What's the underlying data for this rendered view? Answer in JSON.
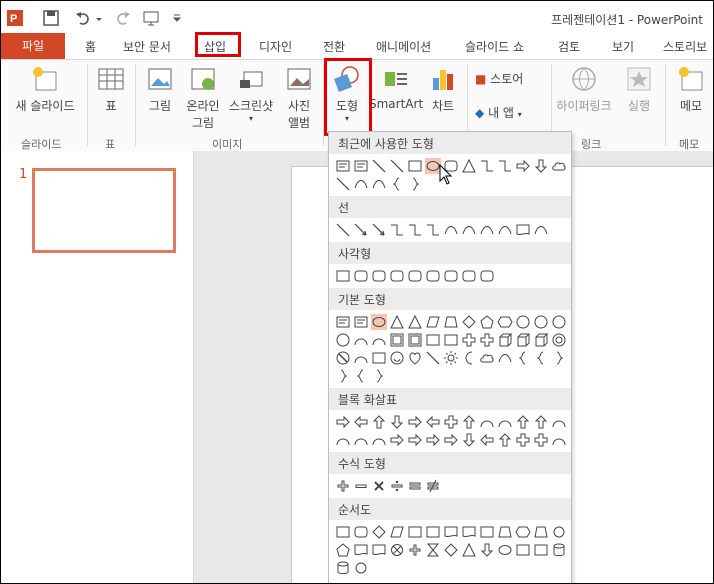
{
  "window": {
    "title": "프레젠테이션1 - PowerPoint"
  },
  "tabs": [
    {
      "label": "파일",
      "name": "tab-file"
    },
    {
      "label": "홈",
      "name": "tab-home"
    },
    {
      "label": "보안 문서",
      "name": "tab-security-document"
    },
    {
      "label": "삽입",
      "name": "tab-insert"
    },
    {
      "label": "디자인",
      "name": "tab-design"
    },
    {
      "label": "전환",
      "name": "tab-transitions"
    },
    {
      "label": "애니메이션",
      "name": "tab-animations"
    },
    {
      "label": "슬라이드 쇼",
      "name": "tab-slideshow"
    },
    {
      "label": "검토",
      "name": "tab-review"
    },
    {
      "label": "보기",
      "name": "tab-view"
    },
    {
      "label": "스토리보",
      "name": "tab-storyboard"
    }
  ],
  "ribbon": {
    "new_slide": "새 슬라이드",
    "table": "표",
    "picture": "그림",
    "online_picture_1": "온라인",
    "online_picture_2": "그림",
    "screenshot": "스크린샷",
    "photo_album_1": "사진",
    "photo_album_2": "앨범",
    "shapes": "도형",
    "smartart": "SmartArt",
    "chart": "차트",
    "store": "스토어",
    "my_apps": "내 앱",
    "hyperlink": "하이퍼링크",
    "action": "실행",
    "memo": "메모",
    "groups": {
      "slides": "슬라이드",
      "tables": "표",
      "images": "이미지",
      "links": "링크",
      "comments": "메모"
    }
  },
  "slides_panel": {
    "slide_number": "1"
  },
  "shapes_menu": {
    "recent": "최근에 사용한 도형",
    "lines": "선",
    "rectangles": "사각형",
    "basic": "기본 도형",
    "block_arrows": "블록 화살표",
    "equation": "수식 도형",
    "flowchart": "순서도"
  },
  "colors": {
    "accent": "#d24726",
    "highlight": "#e00000"
  }
}
